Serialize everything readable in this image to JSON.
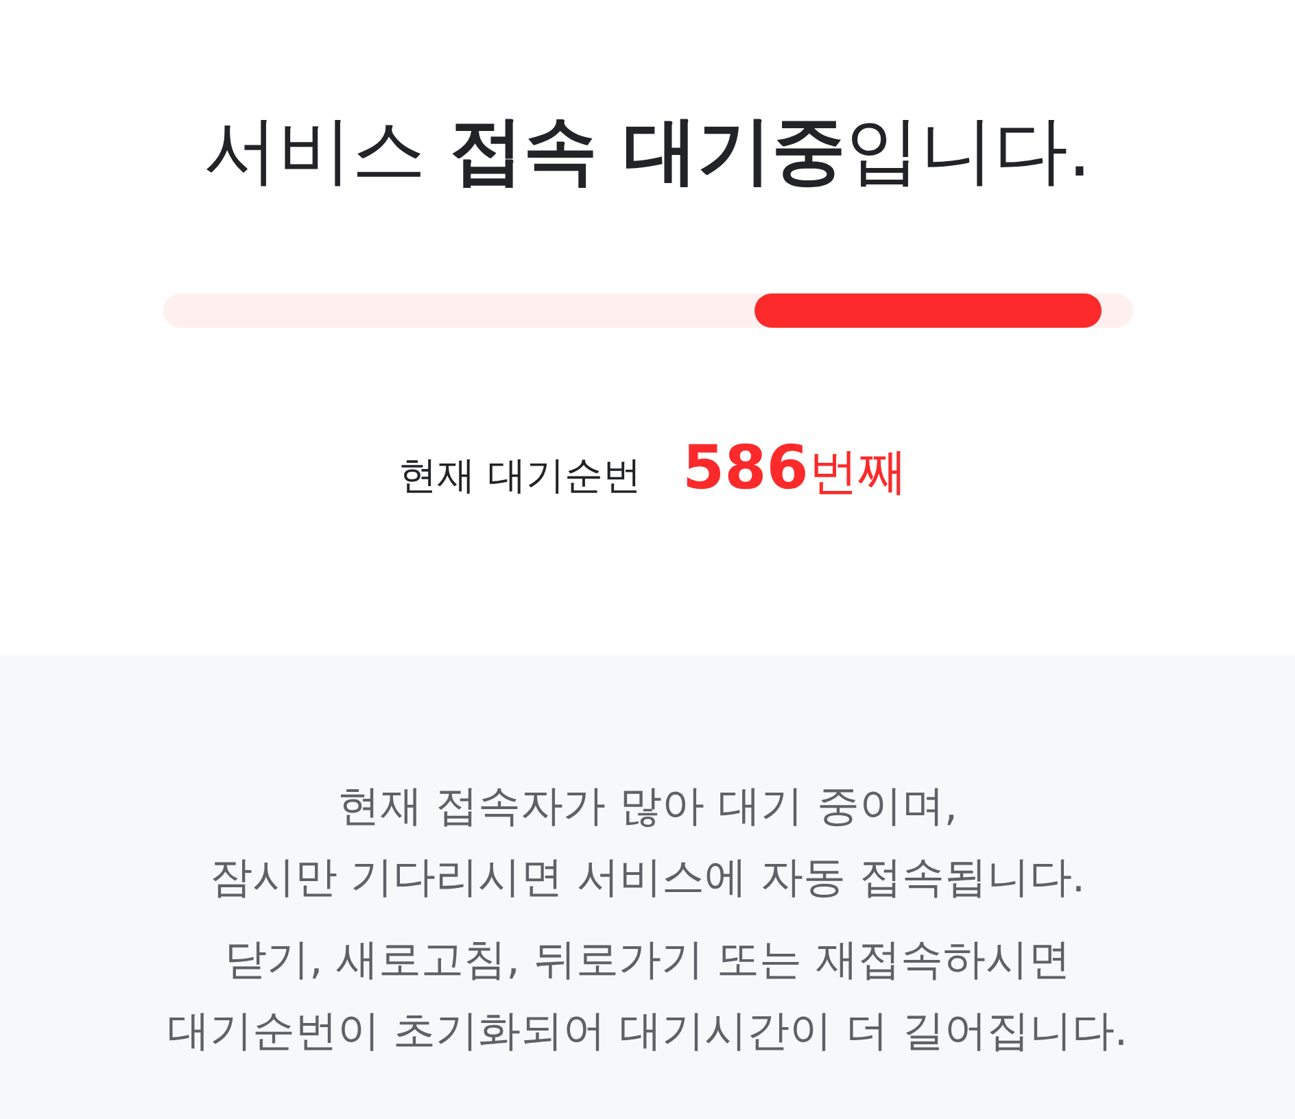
{
  "heading": "서비스 **접속 대기중**입니다.",
  "queue": {
    "label": "현재 대기순번",
    "number": "586",
    "unit": "번째"
  },
  "notice": {
    "paragraphs": [
      [
        "현재 접속자가 많아 대기 중이며,",
        "잠시만 기다리시면 서비스에 자동 접속됩니다."
      ],
      [
        "닫기, 새로고침, 뒤로가기 또는 재접속하시면",
        "대기순번이 초기화되어 대기시간이 더 길어집니다."
      ]
    ]
  }
}
